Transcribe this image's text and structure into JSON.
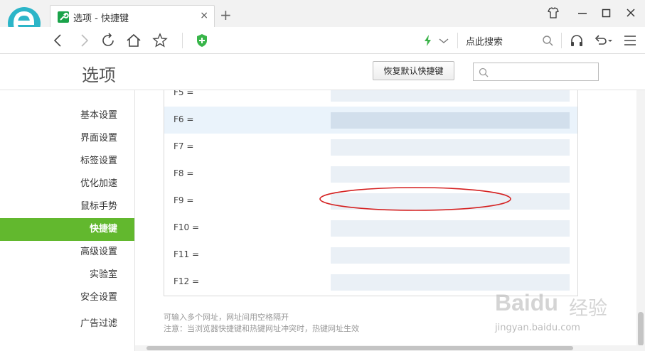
{
  "tab": {
    "title": "选项 - 快捷键",
    "close": "×",
    "new_tab": "+"
  },
  "navbar": {
    "search_engine_label": "点此搜索"
  },
  "header": {
    "title": "选项",
    "restore_button": "恢复默认快捷键",
    "search_placeholder": ""
  },
  "sidebar": {
    "items": [
      {
        "label": "基本设置",
        "active": false
      },
      {
        "label": "界面设置",
        "active": false
      },
      {
        "label": "标签设置",
        "active": false
      },
      {
        "label": "优化加速",
        "active": false
      },
      {
        "label": "鼠标手势",
        "active": false
      },
      {
        "label": "快捷键",
        "active": true
      },
      {
        "label": "高级设置",
        "active": false
      },
      {
        "label": "实验室",
        "active": false
      },
      {
        "label": "安全设置",
        "active": false
      },
      {
        "label": "广告过滤",
        "active": false
      }
    ]
  },
  "shortcuts": {
    "rows": [
      {
        "key": "F5 =",
        "value": ""
      },
      {
        "key": "F6 =",
        "value": ""
      },
      {
        "key": "F7 =",
        "value": ""
      },
      {
        "key": "F8 =",
        "value": ""
      },
      {
        "key": "F9 =",
        "value": ""
      },
      {
        "key": "F10 =",
        "value": ""
      },
      {
        "key": "F11 =",
        "value": ""
      },
      {
        "key": "F12 =",
        "value": ""
      }
    ],
    "hint_1": "可输入多个网址，网址间用空格隔开",
    "hint_2": "注意：当浏览器快捷键和热键网址冲突时，热键网址生效"
  },
  "watermark": {
    "brand": "Baidu",
    "cn": "经验",
    "url": "jingyan.baidu.com"
  },
  "colors": {
    "accent_green": "#62b82e",
    "annotation_red": "#d42020",
    "field_bg": "#eaf0f6"
  }
}
